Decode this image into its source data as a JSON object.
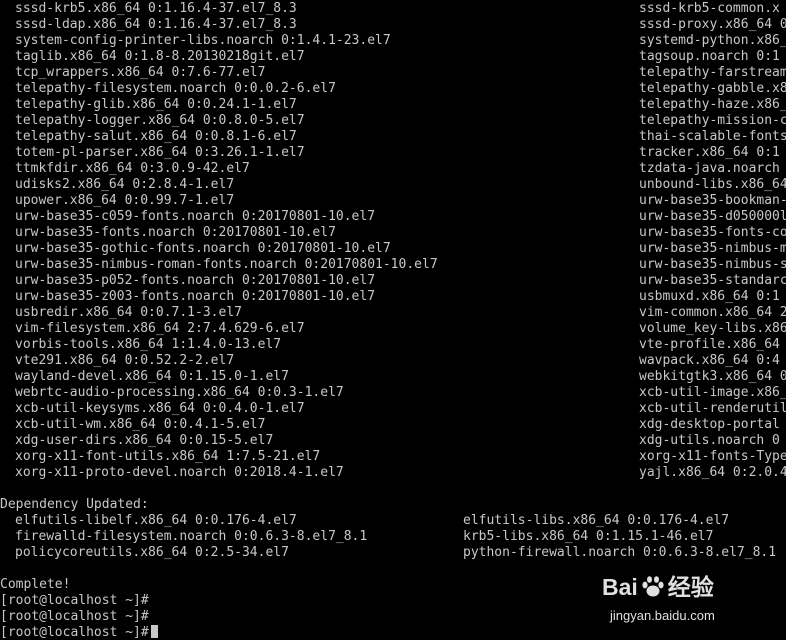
{
  "terminal": {
    "left_lines": [
      "sssd-krb5.x86_64 0:1.16.4-37.el7_8.3",
      "sssd-ldap.x86_64 0:1.16.4-37.el7_8.3",
      "system-config-printer-libs.noarch 0:1.4.1-23.el7",
      "taglib.x86_64 0:1.8-8.20130218git.el7",
      "tcp_wrappers.x86_64 0:7.6-77.el7",
      "telepathy-filesystem.noarch 0:0.0.2-6.el7",
      "telepathy-glib.x86_64 0:0.24.1-1.el7",
      "telepathy-logger.x86_64 0:0.8.0-5.el7",
      "telepathy-salut.x86_64 0:0.8.1-6.el7",
      "totem-pl-parser.x86_64 0:3.26.1-1.el7",
      "ttmkfdir.x86_64 0:3.0.9-42.el7",
      "udisks2.x86_64 0:2.8.4-1.el7",
      "upower.x86_64 0:0.99.7-1.el7",
      "urw-base35-c059-fonts.noarch 0:20170801-10.el7",
      "urw-base35-fonts.noarch 0:20170801-10.el7",
      "urw-base35-gothic-fonts.noarch 0:20170801-10.el7",
      "urw-base35-nimbus-roman-fonts.noarch 0:20170801-10.el7",
      "urw-base35-p052-fonts.noarch 0:20170801-10.el7",
      "urw-base35-z003-fonts.noarch 0:20170801-10.el7",
      "usbredir.x86_64 0:0.7.1-3.el7",
      "vim-filesystem.x86_64 2:7.4.629-6.el7",
      "vorbis-tools.x86_64 1:1.4.0-13.el7",
      "vte291.x86_64 0:0.52.2-2.el7",
      "wayland-devel.x86_64 0:1.15.0-1.el7",
      "webrtc-audio-processing.x86_64 0:0.3-1.el7",
      "xcb-util-keysyms.x86_64 0:0.4.0-1.el7",
      "xcb-util-wm.x86_64 0:0.4.1-5.el7",
      "xdg-user-dirs.x86_64 0:0.15-5.el7",
      "xorg-x11-font-utils.x86_64 1:7.5-21.el7",
      "xorg-x11-proto-devel.noarch 0:2018.4-1.el7"
    ],
    "right_lines": [
      "sssd-krb5-common.x",
      "sssd-proxy.x86_64 0",
      "systemd-python.x86_",
      "tagsoup.noarch 0:1",
      "telepathy-farstream",
      "telepathy-gabble.x8",
      "telepathy-haze.x86_",
      "telepathy-mission-c",
      "thai-scalable-fonts",
      "tracker.x86_64 0:1",
      "tzdata-java.noarch",
      "unbound-libs.x86_64",
      "urw-base35-bookman-",
      "urw-base35-d050000l",
      "urw-base35-fonts-co",
      "urw-base35-nimbus-m",
      "urw-base35-nimbus-s",
      "urw-base35-standarc",
      "usbmuxd.x86_64 0:1",
      "vim-common.x86_64 2",
      "volume_key-libs.x86",
      "vte-profile.x86_64",
      "wavpack.x86_64 0:4",
      "webkitgtk3.x86_64 0",
      "xcb-util-image.x86_",
      "xcb-util-renderutil",
      "xdg-desktop-portal",
      "xdg-utils.noarch 0",
      "xorg-x11-fonts-Type",
      "yajl.x86_64 0:2.0.4"
    ],
    "dep_header": "Dependency Updated:",
    "dep_left": [
      "elfutils-libelf.x86_64 0:0.176-4.el7",
      "firewalld-filesystem.noarch 0:0.6.3-8.el7_8.1",
      "policycoreutils.x86_64 0:2.5-34.el7"
    ],
    "dep_right": [
      "elfutils-libs.x86_64 0:0.176-4.el7",
      "krb5-libs.x86_64 0:1.15.1-46.el7",
      "python-firewall.noarch 0:0.6.3-8.el7_8.1"
    ],
    "complete": "Complete!",
    "prompts": [
      "[root@localhost ~]#",
      "[root@localhost ~]#",
      "[root@localhost ~]#"
    ]
  },
  "watermark": {
    "brand_left": "Bai",
    "brand_right": "经验",
    "url": "jingyan.baidu.com"
  },
  "colors": {
    "background": "#000000",
    "text": "#c8c8c8",
    "watermark": "#ffffff"
  }
}
